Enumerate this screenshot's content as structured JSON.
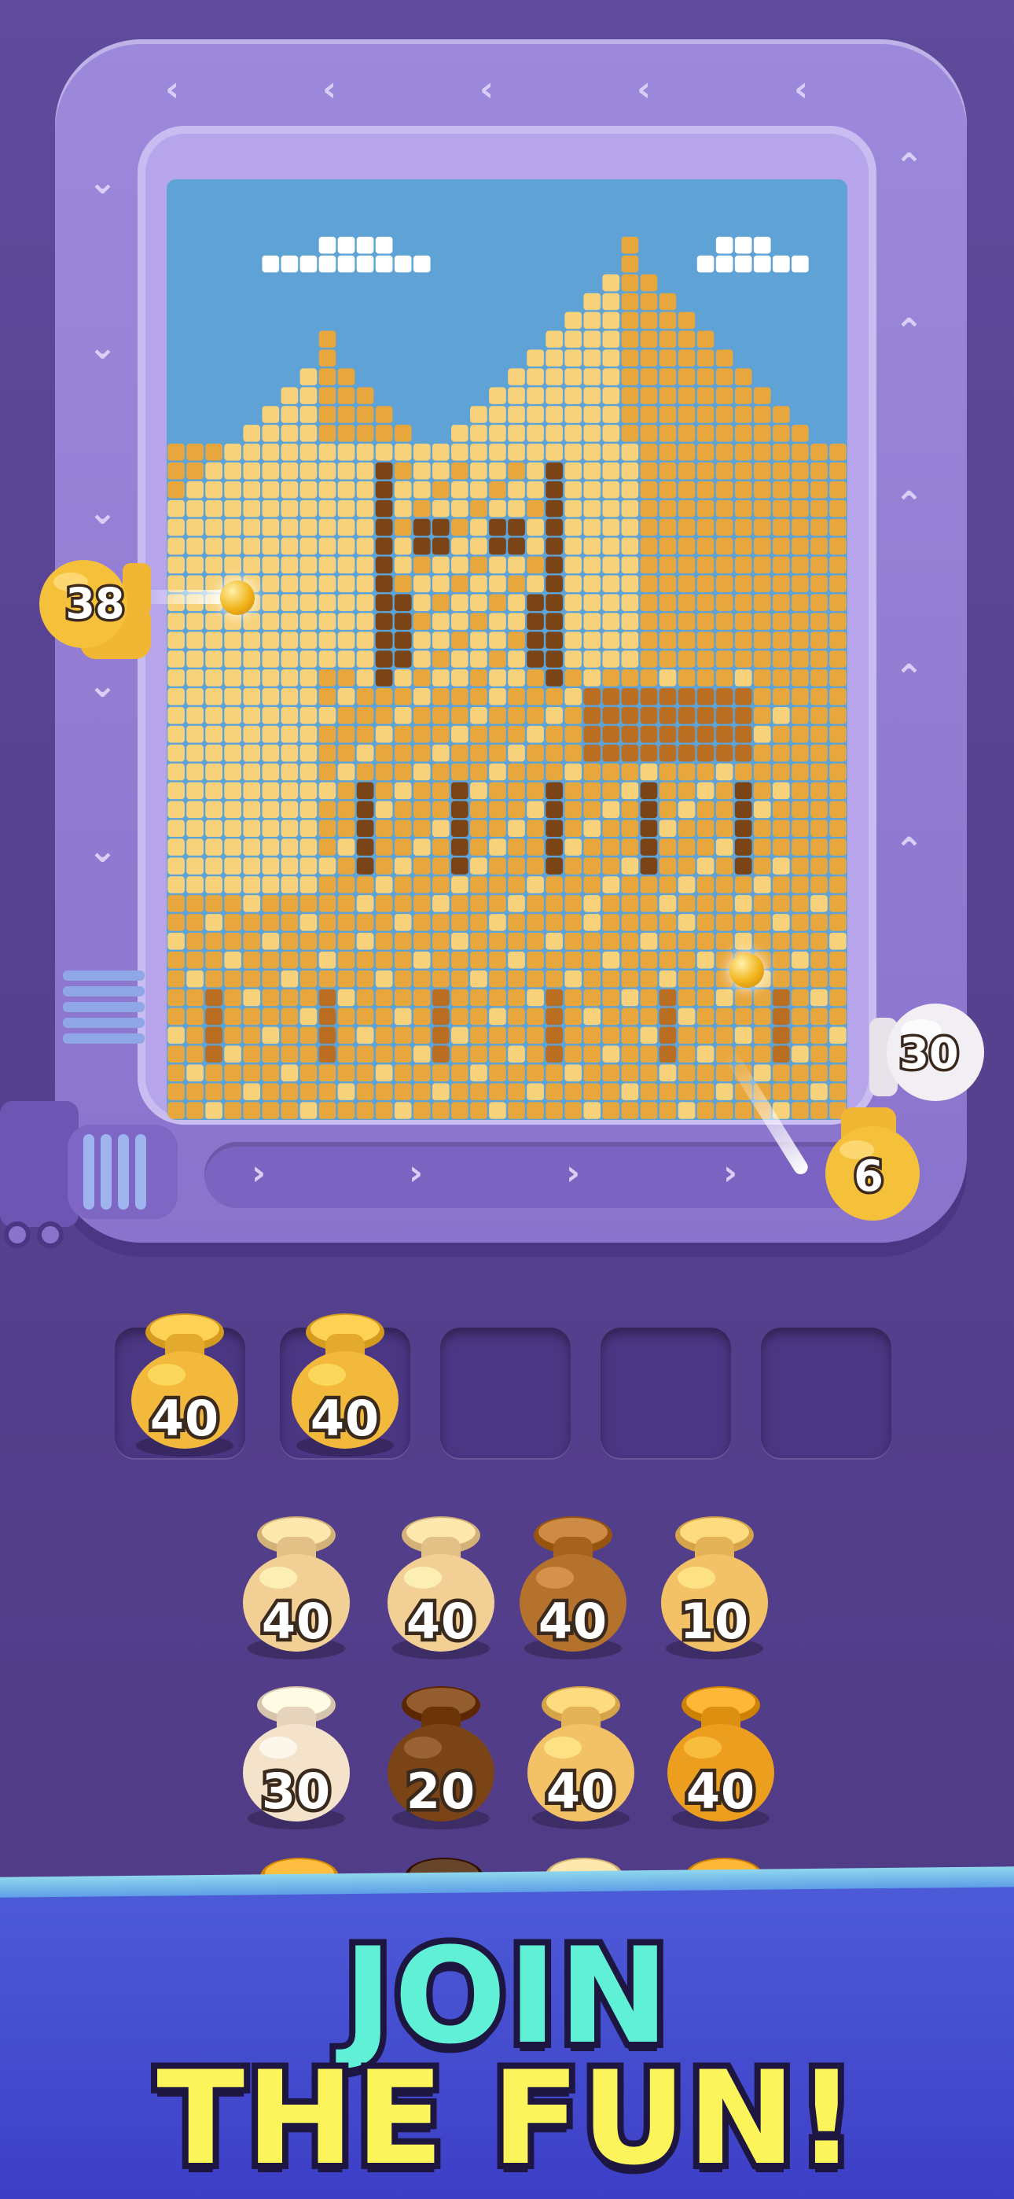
{
  "game": {
    "shooters": {
      "left": "38",
      "right_waiting": "30",
      "bottom_right": "6"
    },
    "queue_slots": [
      {
        "value": "40",
        "color": "#f2b93d",
        "filled": true
      },
      {
        "value": "40",
        "color": "#f2b93d",
        "filled": true
      },
      {
        "value": "",
        "filled": false
      },
      {
        "value": "",
        "filled": false
      },
      {
        "value": "",
        "filled": false
      }
    ],
    "pots": [
      {
        "value": "40",
        "color": "#f1cf95"
      },
      {
        "value": "40",
        "color": "#f1cf95"
      },
      {
        "value": "40",
        "color": "#b5722d"
      },
      {
        "value": "10",
        "color": "#f3c266"
      },
      {
        "value": "30",
        "color": "#f4e2cb"
      },
      {
        "value": "20",
        "color": "#7a4417"
      },
      {
        "value": "40",
        "color": "#f3c266"
      },
      {
        "value": "40",
        "color": "#ec9e1e"
      }
    ],
    "pots_partial_row": [
      "#f0a526",
      "#4e2c12",
      "#f1cf95",
      "#ec9e1e"
    ]
  },
  "colors": {
    "sky": "#5ea2d6",
    "cloud": "#ffffff",
    "pyramid_light": "#f8d27a",
    "pyramid_mid": "#e8a73c",
    "pyramid_dark": "#b96e22",
    "sphinx_shadow": "#7a4417",
    "frame": "#9d89db"
  },
  "banner": {
    "line1": "JOIN",
    "line2": "THE FUN!"
  }
}
